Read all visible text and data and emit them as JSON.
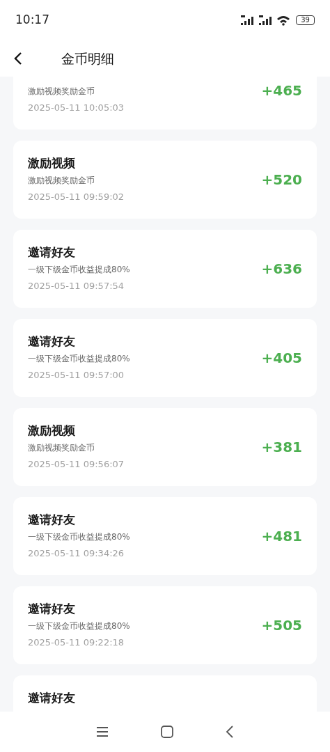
{
  "status_bar": {
    "time": "10:17",
    "battery": "39"
  },
  "header": {
    "title": "金币明细"
  },
  "records": [
    {
      "subtitle": "激励视频奖励金币",
      "time": "2025-05-11 10:05:03",
      "amount": "+465"
    },
    {
      "title": "激励视频",
      "subtitle": "激励视频奖励金币",
      "time": "2025-05-11 09:59:02",
      "amount": "+520"
    },
    {
      "title": "邀请好友",
      "subtitle": "一级下级金币收益提成80%",
      "time": "2025-05-11 09:57:54",
      "amount": "+636"
    },
    {
      "title": "邀请好友",
      "subtitle": "一级下级金币收益提成80%",
      "time": "2025-05-11 09:57:00",
      "amount": "+405"
    },
    {
      "title": "激励视频",
      "subtitle": "激励视频奖励金币",
      "time": "2025-05-11 09:56:07",
      "amount": "+381"
    },
    {
      "title": "邀请好友",
      "subtitle": "一级下级金币收益提成80%",
      "time": "2025-05-11 09:34:26",
      "amount": "+481"
    },
    {
      "title": "邀请好友",
      "subtitle": "一级下级金币收益提成80%",
      "time": "2025-05-11 09:22:18",
      "amount": "+505"
    },
    {
      "title": "邀请好友"
    }
  ]
}
